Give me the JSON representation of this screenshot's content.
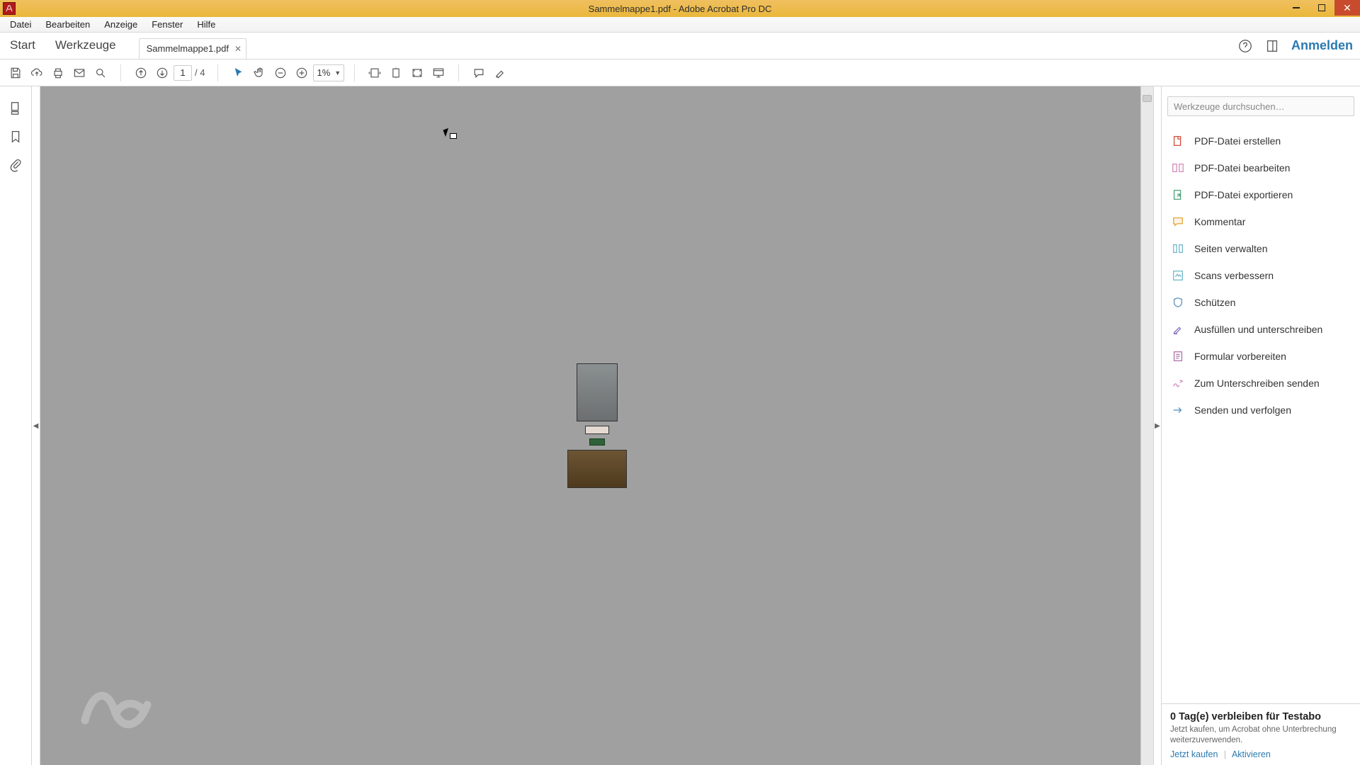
{
  "window": {
    "title": "Sammelmappe1.pdf - Adobe Acrobat Pro DC"
  },
  "menu": {
    "file": "Datei",
    "edit": "Bearbeiten",
    "view": "Anzeige",
    "window": "Fenster",
    "help": "Hilfe"
  },
  "tabs": {
    "start": "Start",
    "tools": "Werkzeuge",
    "open_tab": "Sammelmappe1.pdf",
    "signin": "Anmelden"
  },
  "toolbar": {
    "page_current": "1",
    "page_total": "/ 4",
    "zoom_value": "1%"
  },
  "right_panel": {
    "search_placeholder": "Werkzeuge durchsuchen…",
    "items": [
      {
        "label": "PDF-Datei erstellen",
        "icon": "create-pdf",
        "color": "#d34b3a"
      },
      {
        "label": "PDF-Datei bearbeiten",
        "icon": "edit-pdf",
        "color": "#d18bb5"
      },
      {
        "label": "PDF-Datei exportieren",
        "icon": "export-pdf",
        "color": "#4aa37a"
      },
      {
        "label": "Kommentar",
        "icon": "comment",
        "color": "#e2a83a"
      },
      {
        "label": "Seiten verwalten",
        "icon": "organize",
        "color": "#6fb7c9"
      },
      {
        "label": "Scans verbessern",
        "icon": "enhance",
        "color": "#6fb7c9"
      },
      {
        "label": "Schützen",
        "icon": "protect",
        "color": "#5a8fbf"
      },
      {
        "label": "Ausfüllen und unterschreiben",
        "icon": "fill-sign",
        "color": "#8a6fc1"
      },
      {
        "label": "Formular vorbereiten",
        "icon": "form",
        "color": "#b06fa6"
      },
      {
        "label": "Zum Unterschreiben senden",
        "icon": "send-sign",
        "color": "#d18bb5"
      },
      {
        "label": "Senden und verfolgen",
        "icon": "send-track",
        "color": "#4a8fbf"
      }
    ]
  },
  "trial": {
    "title": "0 Tag(e) verbleiben für Testabo",
    "sub": "Jetzt kaufen, um Acrobat ohne Unterbrechung weiterzuverwenden.",
    "buy": "Jetzt kaufen",
    "activate": "Aktivieren"
  }
}
